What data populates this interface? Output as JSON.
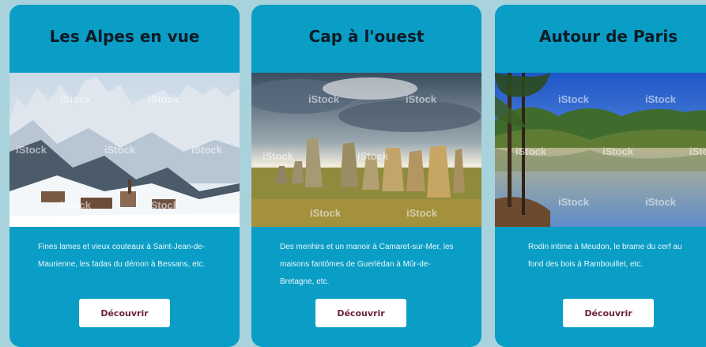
{
  "cards": [
    {
      "title": "Les Alpes en vue",
      "description": "Fines lames et vieux couteaux à Saint-Jean-de-Maurienne, les fadas du démon à Bessans, etc.",
      "button_label": "Découvrir",
      "image_alt": "Alpine village under snow below jagged mountains"
    },
    {
      "title": "Cap à l'ouest",
      "description": "Des menhirs et un manoir à Camaret-sur-Mer, les maisons fantômes de Guerlédan à Mûr-de-Bretagne, etc.",
      "button_label": "Découvrir",
      "image_alt": "Row of standing stones in a grassy field under a dramatic sky"
    },
    {
      "title": "Autour de Paris",
      "description": "Rodin intime à Meudon, le brame du cerf au fond des bois à Rambouillet, etc.",
      "button_label": "Découvrir",
      "image_alt": "Forest pond reflecting trees and blue sky"
    }
  ],
  "watermark_text": "iStock",
  "colors": {
    "page_background": "#a9d3dc",
    "card_background": "#0a9ec6",
    "title_text": "#0e1b26",
    "description_text": "#eaf7fb",
    "button_background": "#ffffff",
    "button_text": "#6a2338"
  }
}
